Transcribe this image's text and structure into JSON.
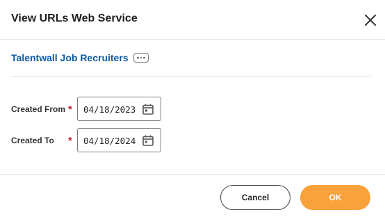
{
  "dialog": {
    "title": "View URLs Web Service"
  },
  "related": {
    "link_text": "Talentwall Job Recruiters"
  },
  "fields": [
    {
      "label": "Created From",
      "required_mark": "*",
      "value": "04/18/2023"
    },
    {
      "label": "Created To",
      "required_mark": "*",
      "value": "04/18/2024"
    }
  ],
  "footer": {
    "cancel_label": "Cancel",
    "ok_label": "OK"
  },
  "colors": {
    "link": "#0b5aa5",
    "required": "#d02030",
    "primary_button": "#f9a13a"
  },
  "icons": {
    "close": "close-icon",
    "related_actions": "more-horizontal-icon",
    "date_picker": "calendar-icon"
  }
}
